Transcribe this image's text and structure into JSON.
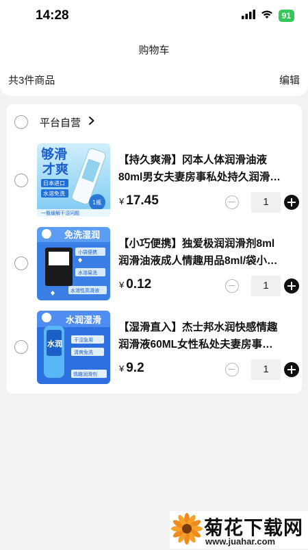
{
  "status_bar": {
    "time": "14:28",
    "battery": "91"
  },
  "header": {
    "title": "购物车",
    "item_count": "共3件商品",
    "edit_label": "编辑"
  },
  "store": {
    "name": "平台自营"
  },
  "products": [
    {
      "title_line1": "【持久爽滑】冈本人体润滑油液",
      "title_line2": "80ml男女夫妻房事私处持久润滑…",
      "currency": "¥",
      "price": "17.45",
      "quantity": "1",
      "thumb": {
        "banner": "够滑",
        "banner2": "才爽",
        "tag1": "日本进口",
        "tag2": "水溶免洗",
        "badge": "1瓶",
        "footer": "一瓶缓解干涩问题"
      }
    },
    {
      "title_line1": "【小巧便携】独爱极润润滑剂8ml",
      "title_line2": "润滑油液成人情趣用品8ml/袋小…",
      "currency": "¥",
      "price": "0.12",
      "quantity": "1",
      "thumb": {
        "banner": "免洗湿润",
        "tag1": "小袋便携",
        "tag2": "水溶易洗",
        "tag3": "水溶性高滑液"
      }
    },
    {
      "title_line1": "【湿滑直入】杰士邦水润快感情趣",
      "title_line2": "润滑液60ML女性私处夫妻房事…",
      "currency": "¥",
      "price": "9.2",
      "quantity": "1",
      "thumb": {
        "banner": "水润湿滑",
        "bottle": "水润",
        "tag1": "干涩急用",
        "tag2": "清爽免洗",
        "tag3": "情趣润滑剂"
      }
    }
  ],
  "watermark": {
    "name": "菊花下载网",
    "url": "www.juahar.com"
  },
  "icons": [
    "signal-icon",
    "wifi-icon",
    "battery-icon",
    "chevron-right-icon",
    "minus-icon",
    "plus-icon"
  ],
  "colors": {
    "background": "#f2f2f2",
    "card": "#ffffff",
    "plus": "#111111",
    "battery": "#34c759",
    "thumb_blue": "#2f6fe0"
  }
}
